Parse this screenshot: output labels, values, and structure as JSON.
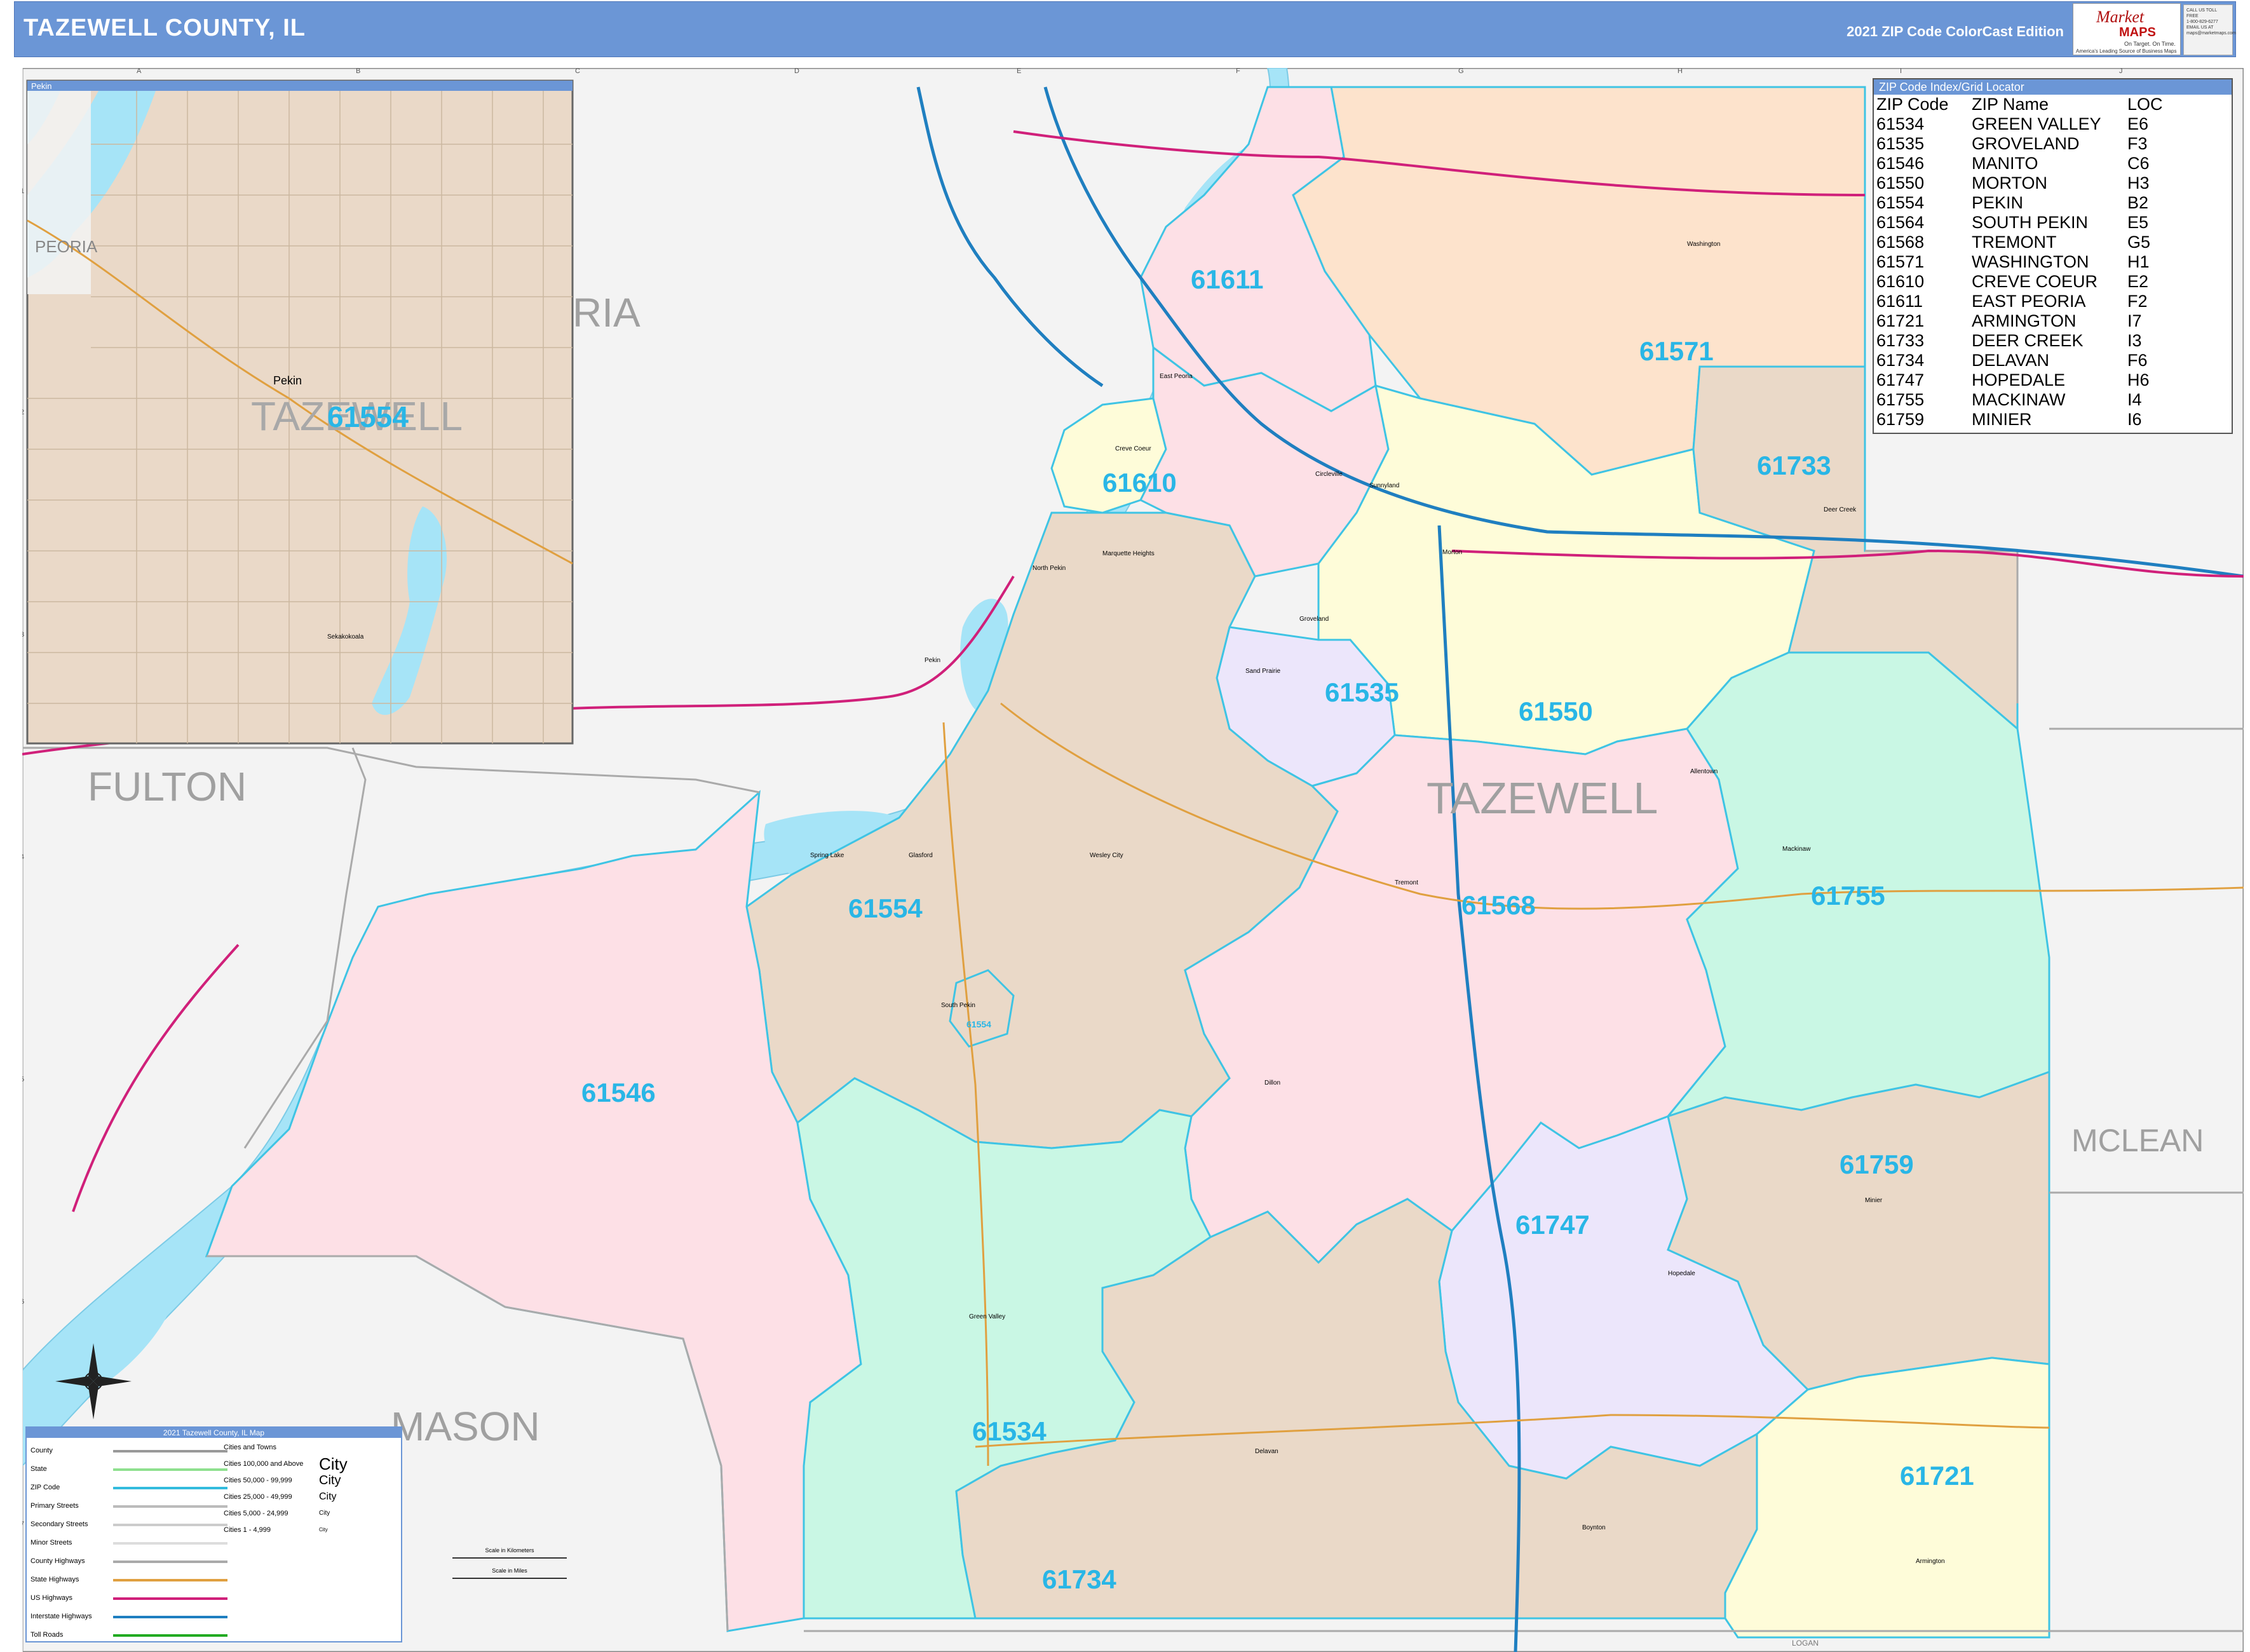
{
  "header": {
    "title": "TAZEWELL COUNTY, IL",
    "edition": "2021 ZIP Code ColorCast Edition"
  },
  "logo": {
    "brand": "Market",
    "maps": "MAPS",
    "tagline1": "On Target. On Time.",
    "tagline2": "America's Leading Source of Business Maps",
    "phone": [
      "CALL US TOLL FREE",
      "1-800-829-6277",
      "EMAIL US AT",
      "maps@marketmaps.com"
    ]
  },
  "grid": {
    "columns": [
      "A",
      "B",
      "C",
      "D",
      "E",
      "F",
      "G",
      "H",
      "I",
      "J"
    ],
    "rows": [
      "1",
      "2",
      "3",
      "4",
      "5",
      "6",
      "7"
    ]
  },
  "county_labels": {
    "fulton": "FULTON",
    "mason": "MASON",
    "mclean": "MCLEAN",
    "peoria_partial": "RIA",
    "tazewell": "TAZEWELL",
    "logan": "LOGAN"
  },
  "inset": {
    "title": "Pekin",
    "city_label": "Pekin",
    "peoria": "PEORIA",
    "tazewell": "TAZEWELL",
    "zip": "61554",
    "small_town": "Sekakokoala"
  },
  "zip_labels": [
    {
      "zip": "61611"
    },
    {
      "zip": "61571"
    },
    {
      "zip": "61610"
    },
    {
      "zip": "61733"
    },
    {
      "zip": "61535"
    },
    {
      "zip": "61550"
    },
    {
      "zip": "61554"
    },
    {
      "zip": "61568"
    },
    {
      "zip": "61755"
    },
    {
      "zip": "61546"
    },
    {
      "zip": "61759"
    },
    {
      "zip": "61747"
    },
    {
      "zip": "61534"
    },
    {
      "zip": "61721"
    },
    {
      "zip": "61734"
    },
    {
      "zip": "61554"
    }
  ],
  "towns": [
    "East Peoria",
    "Creve Coeur",
    "Morton",
    "Washington",
    "Tremont",
    "Mackinaw",
    "Delavan",
    "Hopedale",
    "Minier",
    "Armington",
    "Green Valley",
    "South Pekin",
    "Groveland",
    "Deer Creek",
    "Marquette Heights",
    "North Pekin",
    "Pekin",
    "Dillon",
    "Boynton",
    "Allentown",
    "Sand Prairie",
    "Spring Lake",
    "Circleville",
    "Wesley City",
    "Sunnyland",
    "Glasford"
  ],
  "zip_index": {
    "title": "ZIP Code Index/Grid Locator",
    "headers": [
      "ZIP Code",
      "ZIP Name",
      "LOC"
    ],
    "rows": [
      [
        "61534",
        "GREEN VALLEY",
        "E6"
      ],
      [
        "61535",
        "GROVELAND",
        "F3"
      ],
      [
        "61546",
        "MANITO",
        "C6"
      ],
      [
        "61550",
        "MORTON",
        "H3"
      ],
      [
        "61554",
        "PEKIN",
        "B2"
      ],
      [
        "61564",
        "SOUTH PEKIN",
        "E5"
      ],
      [
        "61568",
        "TREMONT",
        "G5"
      ],
      [
        "61571",
        "WASHINGTON",
        "H1"
      ],
      [
        "61610",
        "CREVE COEUR",
        "E2"
      ],
      [
        "61611",
        "EAST PEORIA",
        "F2"
      ],
      [
        "61721",
        "ARMINGTON",
        "I7"
      ],
      [
        "61733",
        "DEER CREEK",
        "I3"
      ],
      [
        "61734",
        "DELAVAN",
        "F6"
      ],
      [
        "61747",
        "HOPEDALE",
        "H6"
      ],
      [
        "61755",
        "MACKINAW",
        "I4"
      ],
      [
        "61759",
        "MINIER",
        "I6"
      ]
    ]
  },
  "map_legend": {
    "title": "2021 Tazewell County, IL Map",
    "items": [
      {
        "label": "County",
        "color": "#999999"
      },
      {
        "label": "State",
        "color": "#8fe08f"
      },
      {
        "label": "ZIP Code",
        "color": "#33bbdd"
      },
      {
        "label": "Primary Streets",
        "color": "#bbbbbb"
      },
      {
        "label": "Secondary Streets",
        "color": "#cccccc"
      },
      {
        "label": "Minor Streets",
        "color": "#dddddd"
      },
      {
        "label": "County Highways",
        "color": "#aaaaaa"
      },
      {
        "label": "State Highways",
        "color": "#e0a040"
      },
      {
        "label": "US Highways",
        "color": "#d0207a"
      },
      {
        "label": "Interstate Highways",
        "color": "#1f7fc0"
      },
      {
        "label": "Toll Roads",
        "color": "#22aa22"
      }
    ],
    "cities_title": "Cities and Towns",
    "cities": [
      {
        "label": "Cities 100,000 and Above",
        "sample": "City"
      },
      {
        "label": "Cities 50,000 - 99,999",
        "sample": "City"
      },
      {
        "label": "Cities 25,000 - 49,999",
        "sample": "City"
      },
      {
        "label": "Cities 5,000 - 24,999",
        "sample": "City"
      },
      {
        "label": "Cities 1 - 4,999",
        "sample": "City"
      }
    ],
    "scale_km": "Scale in Kilometers",
    "scale_mi": "Scale in Miles"
  },
  "colors": {
    "header": "#6b96d6",
    "water": "#a6e4f7",
    "zip_label": "#29b6e6",
    "pink": "#fde0e6",
    "tan": "#ead9c8",
    "peach": "#fde3cc",
    "yellow": "#fefcd9",
    "mint": "#c9f7e4",
    "lavender": "#ece6fb",
    "zip_border": "#3fc4e4",
    "interstate": "#1f7fc0",
    "us_hwy": "#d0207a",
    "state_hwy": "#e0a040"
  }
}
